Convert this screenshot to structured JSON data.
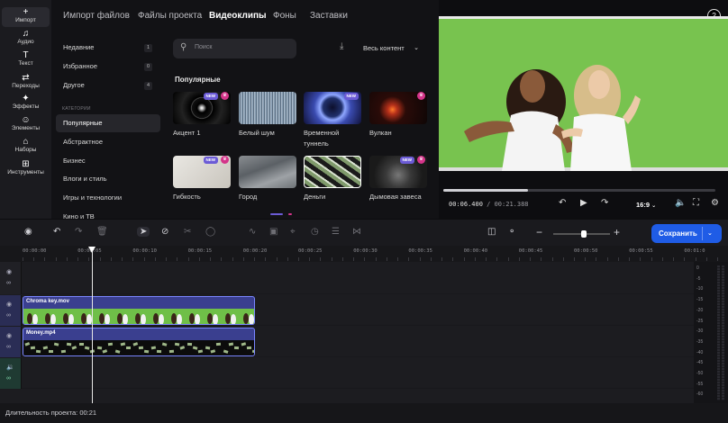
{
  "rail": {
    "items": [
      {
        "label": "Импорт",
        "icon": "plus-icon",
        "glyph": "+"
      },
      {
        "label": "Аудио",
        "icon": "music-note-icon",
        "glyph": "♫"
      },
      {
        "label": "Текст",
        "icon": "text-icon",
        "glyph": "T"
      },
      {
        "label": "Переходы",
        "icon": "transition-icon",
        "glyph": "⇄"
      },
      {
        "label": "Эффекты",
        "icon": "sparkle-icon",
        "glyph": "✦"
      },
      {
        "label": "Элементы",
        "icon": "smiley-icon",
        "glyph": "☺"
      },
      {
        "label": "Наборы",
        "icon": "bag-icon",
        "glyph": "⌂"
      },
      {
        "label": "Инструменты",
        "icon": "grid-icon",
        "glyph": "⊞"
      }
    ]
  },
  "tabs": [
    "Импорт файлов",
    "Файлы проекта",
    "Видеоклипы",
    "Фоны",
    "Заставки"
  ],
  "active_tab": "Видеоклипы",
  "sidebar": {
    "top_items": [
      {
        "label": "Недавние",
        "count": "1"
      },
      {
        "label": "Избранное",
        "count": "0"
      },
      {
        "label": "Другое",
        "count": "4"
      }
    ],
    "categories_header": "КАТЕГОРИИ",
    "categories": [
      "Популярные",
      "Абстрактное",
      "Бизнес",
      "Влоги и стиль",
      "Игры и технологии",
      "Кино и ТВ"
    ],
    "active_category": "Популярные"
  },
  "search": {
    "placeholder": "Поиск"
  },
  "filter": {
    "label": "Весь контент"
  },
  "section_title": "Популярные",
  "clips": [
    {
      "title": "Акцент 1",
      "new": true,
      "crown": true
    },
    {
      "title": "Белый шум",
      "new": false,
      "crown": false
    },
    {
      "title": "Временной туннель",
      "new": true,
      "crown": false
    },
    {
      "title": "Вулкан",
      "new": false,
      "crown": true
    },
    {
      "title": "Гибкость",
      "new": true,
      "crown": true
    },
    {
      "title": "Город",
      "new": false,
      "crown": false
    },
    {
      "title": "Деньги",
      "new": false,
      "crown": false
    },
    {
      "title": "Дымовая завеса",
      "new": true,
      "crown": true
    }
  ],
  "badges": {
    "new": "NEW",
    "crown": "♛"
  },
  "preview": {
    "help": "?",
    "current_time": "00:06.400",
    "total_time": "00:21.388",
    "progress": 0.31,
    "aspect_ratio": "16:9"
  },
  "toolbar": {
    "save_label": "Сохранить",
    "zoom_level": 0.55
  },
  "ruler": [
    "00:00:00",
    "00:00:05",
    "00:00:10",
    "00:00:15",
    "00:00:20",
    "00:00:25",
    "00:00:30",
    "00:00:35",
    "00:00:40",
    "00:00:45",
    "00:00:50",
    "00:00:55",
    "00:01:0"
  ],
  "timeline": {
    "clips": [
      {
        "name": "Chroma key.mov"
      },
      {
        "name": "Money.mp4"
      }
    ],
    "playhead_time": "00:00:06"
  },
  "meters": {
    "labels": [
      "0",
      "-5",
      "-10",
      "-15",
      "-20",
      "-25",
      "-30",
      "-35",
      "-40",
      "-45",
      "-50",
      "-55",
      "-60"
    ]
  },
  "footer": {
    "duration": "Длительность проекта: 00:21"
  },
  "colors": {
    "accent": "#1f5ce6",
    "chroma_green": "#78c34f",
    "clip_border": "#7a86ff",
    "new_badge": "#6b5bd6",
    "crown_badge": "#d4348a"
  }
}
